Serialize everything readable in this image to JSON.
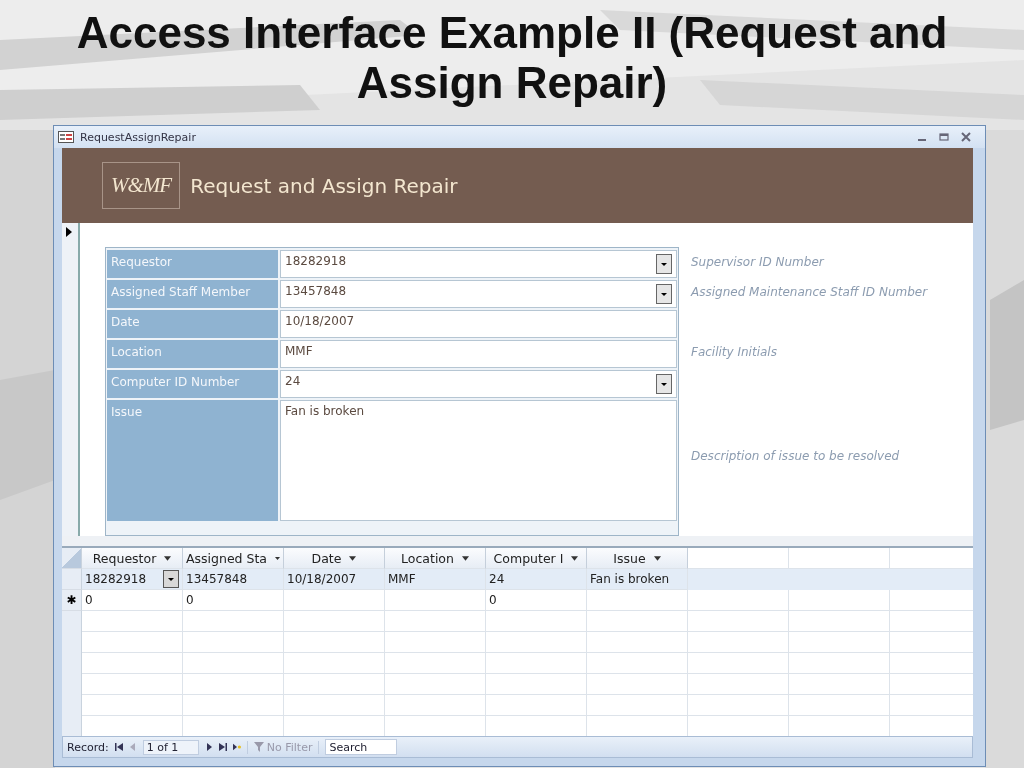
{
  "slide_title": "Access Interface Example II (Request and Assign Repair)",
  "window": {
    "title": "RequestAssignRepair"
  },
  "header": {
    "logo": "W&MF",
    "title": "Request and Assign Repair"
  },
  "form": {
    "fields": [
      {
        "label": "Requestor",
        "value": "18282918",
        "kind": "combo",
        "hint": "Supervisor ID Number"
      },
      {
        "label": "Assigned Staff Member",
        "value": "13457848",
        "kind": "combo",
        "hint": "Assigned Maintenance Staff ID Number"
      },
      {
        "label": "Date",
        "value": "10/18/2007",
        "kind": "text"
      },
      {
        "label": "Location",
        "value": "MMF",
        "kind": "text",
        "hint": "Facility Initials"
      },
      {
        "label": "Computer ID Number",
        "value": "24",
        "kind": "combo"
      },
      {
        "label": "Issue",
        "value": "Fan is broken",
        "kind": "memo",
        "hint": "Description of issue to be resolved"
      }
    ]
  },
  "datasheet": {
    "columns": [
      "Requestor",
      "Assigned Sta",
      "Date",
      "Location",
      "Computer I",
      "Issue"
    ],
    "rows": [
      {
        "selected": true,
        "new": false,
        "cells": [
          {
            "text": "18282918",
            "dropdown": true
          },
          {
            "text": "13457848"
          },
          {
            "text": "10/18/2007"
          },
          {
            "text": "MMF"
          },
          {
            "text": "24"
          },
          {
            "text": "Fan is broken"
          }
        ]
      },
      {
        "selected": false,
        "new": true,
        "marker": "✱",
        "cells": [
          {
            "text": "0"
          },
          {
            "text": "0"
          },
          {},
          {},
          {
            "text": "0"
          },
          {}
        ]
      }
    ]
  },
  "status_bar": {
    "record_label": "Record:",
    "position": "1 of 1",
    "filter": {
      "label": "No Filter",
      "disabled": true
    },
    "search": {
      "placeholder": "Search"
    }
  }
}
